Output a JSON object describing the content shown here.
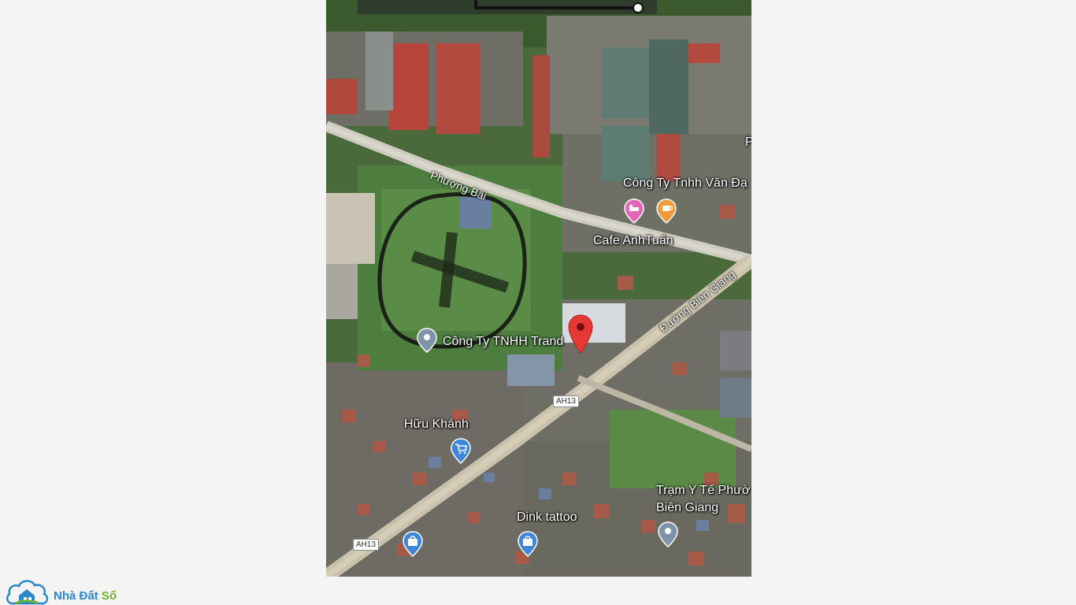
{
  "map": {
    "labels": {
      "road_phuong_bai": "Phượng Bãi",
      "road_bien_giang": "Đường Biên Giang",
      "company_van_dai": "Công Ty Tnhh Văn Đạ",
      "cafe": "Cafe AnhTuấn",
      "company_trand": "Công Ty TNHH Trand",
      "huu_khanh": "Hữu Khánh",
      "tram_y_te_line1": "Trạm Y Tế Phườ",
      "tram_y_te_line2": "Biên Giang",
      "dink_tattoo": "Dink tattoo",
      "edge_letter": "P"
    },
    "shields": {
      "ah13_a": "AH13",
      "ah13_b": "AH13"
    },
    "icons": [
      "hotel-pin-icon",
      "cafe-pin-icon",
      "place-pin-icon",
      "red-location-pin-icon",
      "shopping-cart-pin-icon",
      "shopping-bag-pin-icon",
      "medical-pin-icon",
      "hand-drawn-circle-x-mark"
    ]
  },
  "logo": {
    "part1": "Nhà Đất ",
    "part2": "Số",
    "colors": {
      "primary": "#2d86c9",
      "secondary": "#6fb432"
    }
  }
}
